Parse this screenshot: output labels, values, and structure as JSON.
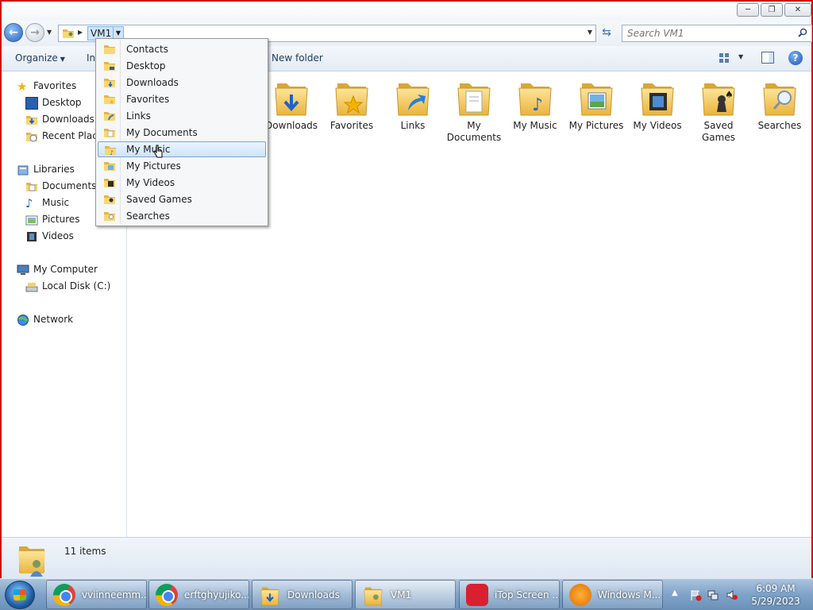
{
  "window": {
    "title": "VM1",
    "controls": {
      "minimize": "─",
      "maximize": "❐",
      "close": "✕"
    }
  },
  "address": {
    "breadcrumb": "VM1",
    "search_placeholder": "Search VM1"
  },
  "commands": {
    "organize": "Organize",
    "include": "In",
    "new_folder": "New folder"
  },
  "nav": {
    "favorites_header": "Favorites",
    "favorites": [
      "Desktop",
      "Downloads",
      "Recent Places"
    ],
    "libraries_header": "Libraries",
    "libraries": [
      "Documents",
      "Music",
      "Pictures",
      "Videos"
    ],
    "computer_header": "My Computer",
    "computer": [
      "Local Disk (C:)"
    ],
    "network_header": "Network"
  },
  "menu": {
    "items": [
      "Contacts",
      "Desktop",
      "Downloads",
      "Favorites",
      "Links",
      "My Documents",
      "My Music",
      "My Pictures",
      "My Videos",
      "Saved Games",
      "Searches"
    ],
    "highlighted": "My Music"
  },
  "content": {
    "tiles": [
      "Downloads",
      "Favorites",
      "Links",
      "My Documents",
      "My Music",
      "My Pictures",
      "My Videos",
      "Saved Games",
      "Searches"
    ]
  },
  "status": {
    "count_text": "11 items"
  },
  "taskbar": {
    "buttons": [
      "vviinneemm...",
      "erftghyujiko...",
      "Downloads",
      "VM1",
      "iTop Screen ...",
      "Windows M..."
    ],
    "active": "VM1",
    "clock_time": "6:09 AM",
    "clock_date": "5/29/2023"
  },
  "colors": {
    "accent": "#3f6fb6",
    "folder": "#f2c75c",
    "highlight": "#cfe4fa",
    "border_red": "#d40000"
  }
}
